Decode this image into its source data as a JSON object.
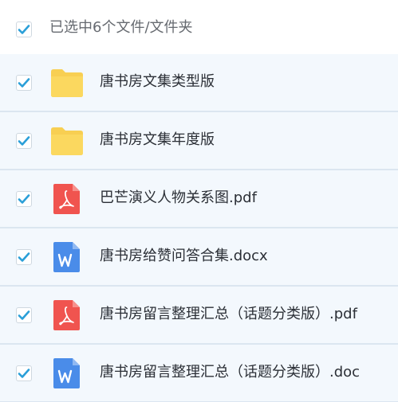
{
  "header": {
    "selection_label": "已选中6个文件/文件夹",
    "checked": true
  },
  "files": [
    {
      "name": "唐书房文集类型版",
      "type": "folder",
      "icon": "folder-icon",
      "checked": true
    },
    {
      "name": "唐书房文集年度版",
      "type": "folder",
      "icon": "folder-icon",
      "checked": true
    },
    {
      "name": "巴芒演义人物关系图.pdf",
      "type": "pdf",
      "icon": "pdf-icon",
      "checked": true
    },
    {
      "name": "唐书房给赞问答合集.docx",
      "type": "word",
      "icon": "word-doc-icon",
      "checked": true
    },
    {
      "name": "唐书房留言整理汇总（话题分类版）.pdf",
      "type": "pdf",
      "icon": "pdf-icon",
      "checked": true
    },
    {
      "name": "唐书房留言整理汇总（话题分类版）.doc",
      "type": "word",
      "icon": "word-doc-icon",
      "checked": true
    }
  ],
  "colors": {
    "checkmark": "#2a9fd8",
    "folder": "#f8cf52",
    "pdf": "#f0544f",
    "word": "#4a8ce9",
    "row_background": "#f3f8fd"
  }
}
